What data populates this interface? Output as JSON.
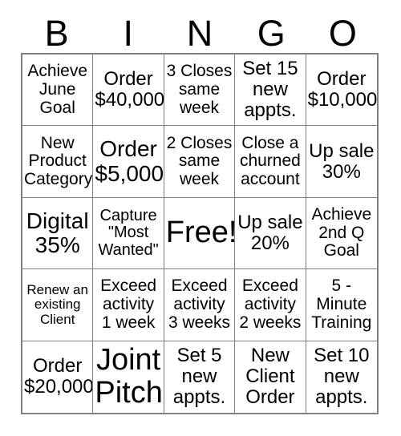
{
  "header": {
    "letters": [
      "B",
      "I",
      "N",
      "G",
      "O"
    ]
  },
  "colors": {
    "grid_border": "#808080",
    "cell_border": "#808080",
    "text": "#000000",
    "background": "#ffffff"
  },
  "grid": {
    "columns": 5,
    "rows": 5,
    "cells": [
      {
        "text": "Achieve\nJune\nGoal",
        "size": "fs-m"
      },
      {
        "text": "Order\n$40,000",
        "size": "fs-l"
      },
      {
        "text": "3 Closes\nsame\nweek",
        "size": "fs-m"
      },
      {
        "text": "Set 15\nnew\nappts.",
        "size": "fs-l"
      },
      {
        "text": "Order\n$10,000",
        "size": "fs-l"
      },
      {
        "text": "New\nProduct\nCategory",
        "size": "fs-m"
      },
      {
        "text": "Order\n$5,000",
        "size": "fs-xl"
      },
      {
        "text": "2 Closes\nsame\nweek",
        "size": "fs-m"
      },
      {
        "text": "Close a\nchurned\naccount",
        "size": "fs-m"
      },
      {
        "text": "Up sale\n30%",
        "size": "fs-l"
      },
      {
        "text": "Digital\n35%",
        "size": "fs-xl"
      },
      {
        "text": "Capture\n\"Most\nWanted\"",
        "size": "fs-s"
      },
      {
        "text": "Free!",
        "size": "fs-xxl"
      },
      {
        "text": "Up sale\n20%",
        "size": "fs-l"
      },
      {
        "text": "Achieve\n2nd Q\nGoal",
        "size": "fs-m"
      },
      {
        "text": "Renew an\nexisting\nClient",
        "size": "fs-xs"
      },
      {
        "text": "Exceed\nactivity\n1 week",
        "size": "fs-m"
      },
      {
        "text": "Exceed\nactivity\n3 weeks",
        "size": "fs-m"
      },
      {
        "text": "Exceed\nactivity\n2 weeks",
        "size": "fs-m"
      },
      {
        "text": "5 -\nMinute\nTraining",
        "size": "fs-m"
      },
      {
        "text": "Order\n$20,000",
        "size": "fs-l"
      },
      {
        "text": "Joint\nPitch",
        "size": "fs-xxl"
      },
      {
        "text": "Set 5\nnew\nappts.",
        "size": "fs-l"
      },
      {
        "text": "New\nClient\nOrder",
        "size": "fs-l"
      },
      {
        "text": "Set 10\nnew\nappts.",
        "size": "fs-l"
      }
    ]
  }
}
